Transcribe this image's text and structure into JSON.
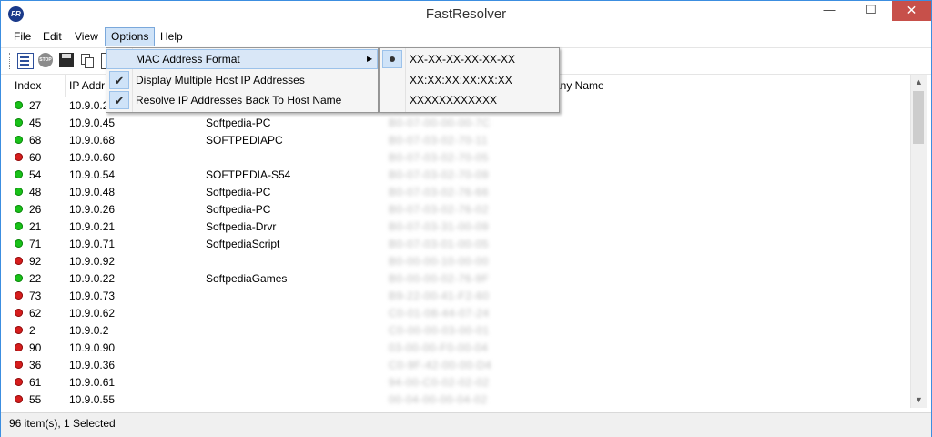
{
  "window": {
    "title": "FastResolver",
    "icon_text": "FR"
  },
  "titlebar_buttons": {
    "minimize": "—",
    "maximize": "☐",
    "close": "✕"
  },
  "menubar": [
    "File",
    "Edit",
    "View",
    "Options",
    "Help"
  ],
  "toolbar": {
    "buttons": [
      "properties-icon",
      "stop-icon",
      "save-icon",
      "copy-icon",
      "report-icon"
    ],
    "stop_text": "STOP"
  },
  "columns": [
    "Index",
    "IP Addr",
    "",
    "",
    "any Name"
  ],
  "rows": [
    {
      "index": "27",
      "ip": "10.9.0.2",
      "host": "",
      "mac": "XX-XX-XX-XX-XX-XX",
      "status": "green"
    },
    {
      "index": "45",
      "ip": "10.9.0.45",
      "host": "Softpedia-PC",
      "mac": "B0-07-00-00-00-7C",
      "status": "green"
    },
    {
      "index": "68",
      "ip": "10.9.0.68",
      "host": "SOFTPEDIAPC",
      "mac": "B0-07-03-02-70-11",
      "status": "green"
    },
    {
      "index": "60",
      "ip": "10.9.0.60",
      "host": "",
      "mac": "B0-07-03-02-70-05",
      "status": "red"
    },
    {
      "index": "54",
      "ip": "10.9.0.54",
      "host": "SOFTPEDIA-S54",
      "mac": "B0-07-03-02-70-09",
      "status": "green"
    },
    {
      "index": "48",
      "ip": "10.9.0.48",
      "host": "Softpedia-PC",
      "mac": "B0-07-03-02-76-66",
      "status": "green"
    },
    {
      "index": "26",
      "ip": "10.9.0.26",
      "host": "Softpedia-PC",
      "mac": "B0-07-03-02-76-02",
      "status": "green"
    },
    {
      "index": "21",
      "ip": "10.9.0.21",
      "host": "Softpedia-Drvr",
      "mac": "B0-07-03-31-00-09",
      "status": "green"
    },
    {
      "index": "71",
      "ip": "10.9.0.71",
      "host": "SoftpediaScript",
      "mac": "B0-07-03-01-00-05",
      "status": "green"
    },
    {
      "index": "92",
      "ip": "10.9.0.92",
      "host": "",
      "mac": "B0-00-00-10-00-00",
      "status": "red"
    },
    {
      "index": "22",
      "ip": "10.9.0.22",
      "host": "SoftpediaGames",
      "mac": "B0-00-00-02-76-9F",
      "status": "green"
    },
    {
      "index": "73",
      "ip": "10.9.0.73",
      "host": "",
      "mac": "B9-22-00-41-F2-60",
      "status": "red"
    },
    {
      "index": "62",
      "ip": "10.9.0.62",
      "host": "",
      "mac": "C0-01-08-44-07-24",
      "status": "red"
    },
    {
      "index": "2",
      "ip": "10.9.0.2",
      "host": "",
      "mac": "C0-00-00-03-00-01",
      "status": "red"
    },
    {
      "index": "90",
      "ip": "10.9.0.90",
      "host": "",
      "mac": "03-00-00-F0-00-04",
      "status": "red"
    },
    {
      "index": "36",
      "ip": "10.9.0.36",
      "host": "",
      "mac": "C0-9F-42-00-00-D4",
      "status": "red"
    },
    {
      "index": "61",
      "ip": "10.9.0.61",
      "host": "",
      "mac": "94-00-C0-02-02-02",
      "status": "red"
    },
    {
      "index": "55",
      "ip": "10.9.0.55",
      "host": "",
      "mac": "00-04-00-00-04-02",
      "status": "red"
    }
  ],
  "options_menu": {
    "items": [
      {
        "label": "MAC Address Format",
        "checked": false,
        "submenu": true
      },
      {
        "label": "Display Multiple Host IP Addresses",
        "checked": true,
        "submenu": false
      },
      {
        "label": "Resolve IP Addresses Back To Host Name",
        "checked": true,
        "submenu": false
      }
    ]
  },
  "mac_format_submenu": {
    "items": [
      {
        "label": "XX-XX-XX-XX-XX-XX",
        "selected": true
      },
      {
        "label": "XX:XX:XX:XX:XX:XX",
        "selected": false
      },
      {
        "label": "XXXXXXXXXXXX",
        "selected": false
      }
    ]
  },
  "status": "96 item(s), 1 Selected",
  "colors": {
    "accent": "#3c8ee0",
    "close_button": "#c7504a",
    "status_green": "#19c119",
    "status_red": "#d61d1d",
    "menu_highlight": "#d9e7f7"
  }
}
